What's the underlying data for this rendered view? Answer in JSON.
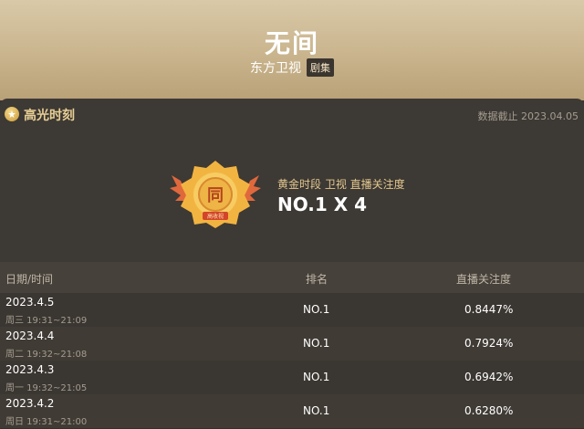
{
  "header": {
    "title": "无间",
    "channel": "东方卫视",
    "tag": "剧集"
  },
  "highlight": {
    "title": "高光时刻",
    "data_date": "数据截止 2023.04.05"
  },
  "medal": {
    "text": "同",
    "ribbon": "高收视"
  },
  "stat": {
    "label": "黄金时段 卫视 直播关注度",
    "value": "NO.1 X 4"
  },
  "table": {
    "headers": {
      "date": "日期/时间",
      "rank": "排名",
      "rating": "直播关注度"
    },
    "rows": [
      {
        "date": "2023.4.5",
        "time": "周三 19:31~21:09",
        "rank": "NO.1",
        "rating": "0.8447%"
      },
      {
        "date": "2023.4.4",
        "time": "周二 19:32~21:08",
        "rank": "NO.1",
        "rating": "0.7924%"
      },
      {
        "date": "2023.4.3",
        "time": "周一 19:32~21:05",
        "rank": "NO.1",
        "rating": "0.6942%"
      },
      {
        "date": "2023.4.2",
        "time": "周日 19:31~21:00",
        "rank": "NO.1",
        "rating": "0.6280%"
      }
    ]
  },
  "colors": {
    "gold": "#e8cf95",
    "panel": "#3d3934",
    "header": "#c9b48d"
  }
}
